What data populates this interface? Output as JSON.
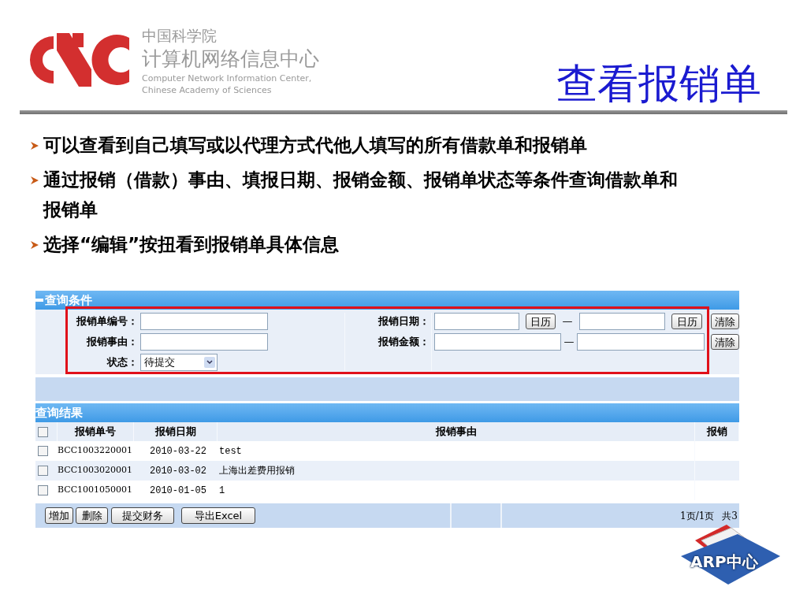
{
  "header": {
    "institution": "中国科学院",
    "center": "计算机网络信息中心",
    "english_line_1": "Computer Network Information Center,",
    "english_line_2": "Chinese Academy of Sciences",
    "title": "查看报销单"
  },
  "bullets": [
    {
      "text": "可以查看到自己填写或以代理方式代他人填写的所有借款单和报销单"
    },
    {
      "text": "通过报销（借款）事由、填报日期、报销金额、报销单状态等条件查询借款单和报销单"
    },
    {
      "text": "选择“编辑”按扭看到报销单具体信息"
    }
  ],
  "query": {
    "title": "查询条件",
    "expanded": true,
    "left_fields": [
      {
        "label": "报销单编号：",
        "kind": "text"
      },
      {
        "label": "报销事由：",
        "kind": "text"
      },
      {
        "label": "状态：",
        "kind": "select",
        "value": "待提交"
      }
    ],
    "right_fields": [
      {
        "label": "报销日期：",
        "kind": "date_range",
        "separator": "—",
        "calendar_buttons": [
          "日历",
          "日历"
        ],
        "clear": "清除"
      },
      {
        "label": "报销金额：",
        "kind": "range",
        "separator": "—",
        "clear": "清除"
      }
    ]
  },
  "results": {
    "title": "查询结果",
    "header_checked": false,
    "columns": [
      "报销单号",
      "报销日期",
      "报销事由",
      "报销"
    ],
    "rows": [
      {
        "checked": false,
        "number": "BCC1003220001",
        "date": "2010-03-22",
        "reason": "test"
      },
      {
        "checked": false,
        "number": "BCC1003020001",
        "date": "2010-03-02",
        "reason": "上海出差费用报销"
      },
      {
        "checked": false,
        "number": "BCC1001050001",
        "date": "2010-01-05",
        "reason": "1"
      }
    ],
    "buttons": [
      "增加",
      "删除",
      "提交财务",
      "导出Excel"
    ],
    "pages": "1页/1页",
    "total": "共3"
  },
  "badge": {
    "text": "ARP中心"
  }
}
